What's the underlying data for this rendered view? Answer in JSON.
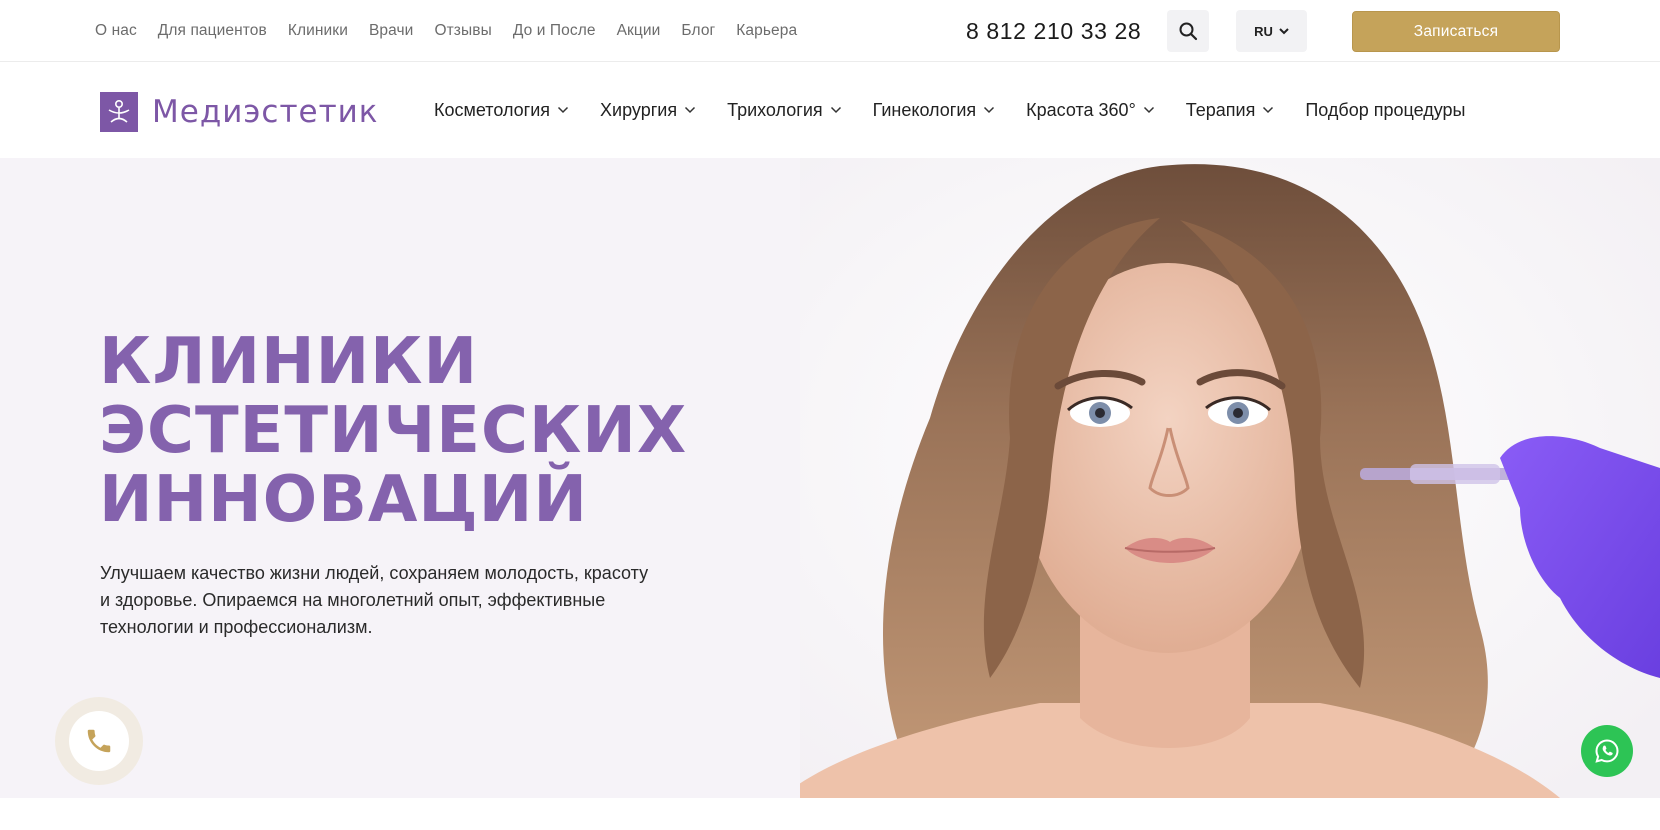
{
  "topbar": {
    "links": [
      "О нас",
      "Для пациентов",
      "Клиники",
      "Врачи",
      "Отзывы",
      "До и После",
      "Акции",
      "Блог",
      "Карьера"
    ],
    "phone": "8 812 210 33 28",
    "lang": "RU",
    "cta_label": "Записаться",
    "accent_color": "#c5a35a"
  },
  "brand": {
    "name": "Медиэстетик",
    "color": "#7d57a6"
  },
  "mainnav": {
    "items": [
      {
        "label": "Косметология",
        "has_dropdown": true
      },
      {
        "label": "Хирургия",
        "has_dropdown": true
      },
      {
        "label": "Трихология",
        "has_dropdown": true
      },
      {
        "label": "Гинекология",
        "has_dropdown": true
      },
      {
        "label": "Красота 360°",
        "has_dropdown": true
      },
      {
        "label": "Терапия",
        "has_dropdown": true
      },
      {
        "label": "Подбор процедуры",
        "has_dropdown": false
      }
    ]
  },
  "hero": {
    "title_lines": [
      "КЛИНИКИ",
      "ЭСТЕТИЧЕСКИХ",
      "ИННОВАЦИЙ"
    ],
    "subtitle": "Улучшаем качество жизни людей, сохраняем молодость, красоту и здоровье. Опираемся на многолетний опыт, эффективные технологии и профессионализм.",
    "title_color": "#8462ad"
  },
  "floating": {
    "call_icon": "phone-icon",
    "whatsapp_icon": "whatsapp-icon",
    "whatsapp_color": "#2dc455"
  }
}
